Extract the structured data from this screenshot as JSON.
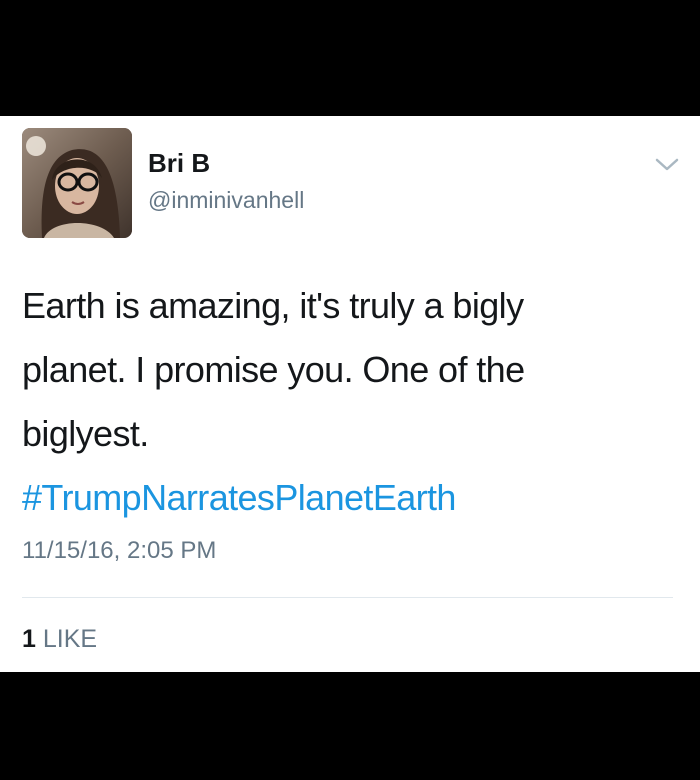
{
  "tweet": {
    "display_name": "Bri B",
    "handle": "@inminivanhell",
    "text_lines": [
      "Earth is amazing, it's truly a bigly",
      "planet.  I promise you. One of the",
      "biglyest."
    ],
    "hashtag": "#TrumpNarratesPlanetEarth",
    "timestamp": "11/15/16, 2:05 PM",
    "like_count": "1",
    "like_label": "LIKE"
  },
  "icons": {
    "menu": "chevron-down-icon",
    "avatar": "avatar"
  },
  "colors": {
    "text": "#14171a",
    "secondary": "#657786",
    "link": "#1b95e0",
    "divider": "#e1e8ed",
    "chevron": "#aab8c2"
  }
}
